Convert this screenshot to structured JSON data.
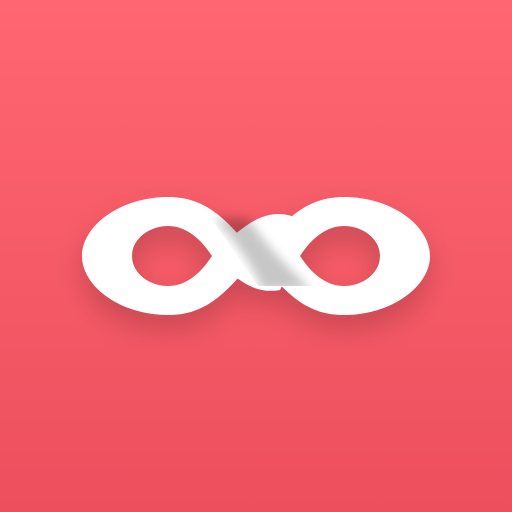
{
  "app_icon": {
    "icon_name": "infinity-icon",
    "colors": {
      "background_top": "#ff6671",
      "background_bottom": "#ed4f5d",
      "symbol": "#ffffff",
      "shadow": "#000000"
    }
  }
}
